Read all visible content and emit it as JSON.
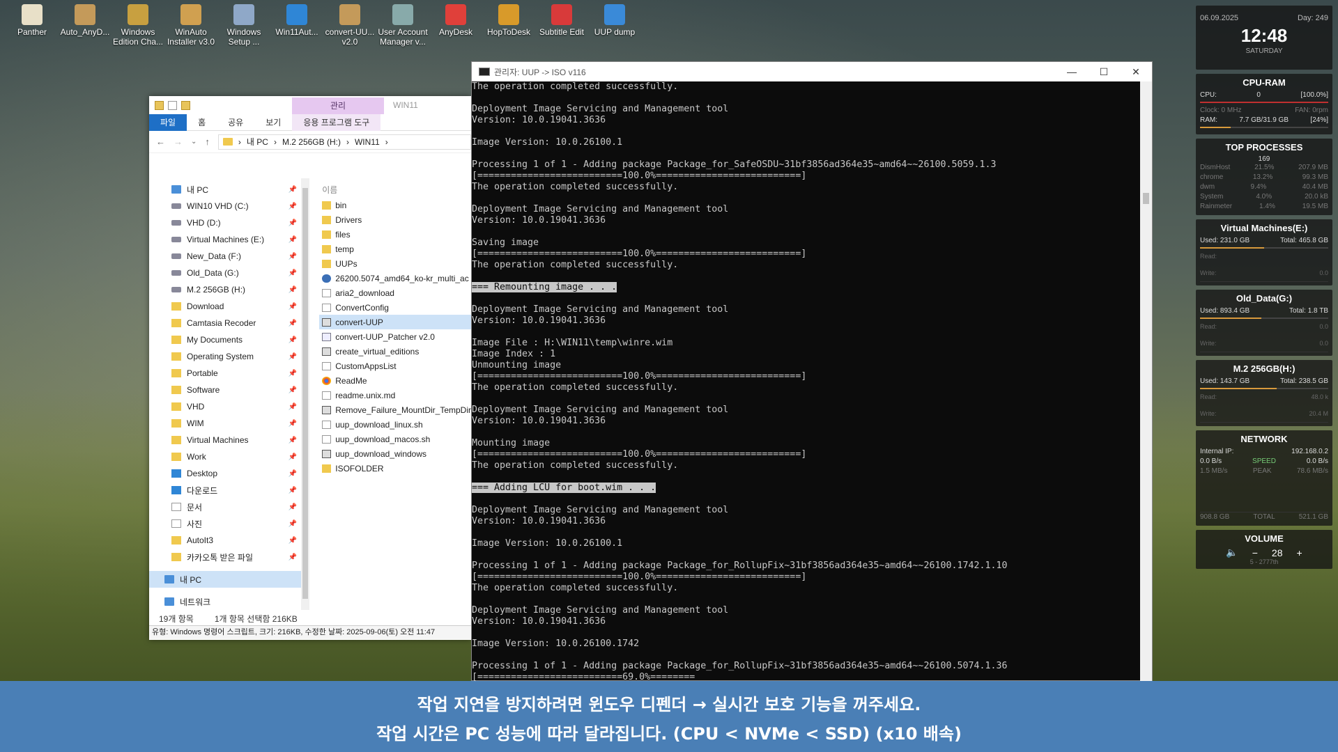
{
  "desktop_icons": [
    {
      "label": "Panther",
      "color": "#e8e0c8"
    },
    {
      "label": "Auto_AnyD...",
      "color": "#c49a5a"
    },
    {
      "label": "Windows Edition Cha...",
      "color": "#c8a040"
    },
    {
      "label": "WinAuto Installer v3.0",
      "color": "#d0a050"
    },
    {
      "label": "Windows Setup ...",
      "color": "#8fa8c8"
    },
    {
      "label": "Win11Aut...",
      "color": "#2f86d6"
    },
    {
      "label": "convert-UU... v2.0",
      "color": "#c49a5a"
    },
    {
      "label": "User Account Manager v...",
      "color": "#8aa"
    },
    {
      "label": "AnyDesk",
      "color": "#e0403a"
    },
    {
      "label": "HopToDesk",
      "color": "#d89a2a"
    },
    {
      "label": "Subtitle Edit",
      "color": "#d83a3a"
    },
    {
      "label": "UUP dump",
      "color": "#3a8ad8"
    }
  ],
  "explorer": {
    "manage_tab": "관리",
    "window_name": "WIN11",
    "ribbon_tabs": [
      "파일",
      "홈",
      "공유",
      "보기",
      "응용 프로그램 도구"
    ],
    "breadcrumb": [
      "내 PC",
      "M.2 256GB (H:)",
      "WIN11"
    ],
    "nav_items": [
      {
        "label": "내 PC",
        "type": "pc"
      },
      {
        "label": "WIN10 VHD (C:)",
        "type": "drive"
      },
      {
        "label": "VHD (D:)",
        "type": "drive"
      },
      {
        "label": "Virtual Machines (E:)",
        "type": "drive"
      },
      {
        "label": "New_Data (F:)",
        "type": "drive"
      },
      {
        "label": "Old_Data (G:)",
        "type": "drive"
      },
      {
        "label": "M.2 256GB (H:)",
        "type": "drive"
      },
      {
        "label": "Download",
        "type": "folder"
      },
      {
        "label": "Camtasia Recoder",
        "type": "folder"
      },
      {
        "label": "My Documents",
        "type": "folder"
      },
      {
        "label": "Operating System",
        "type": "folder"
      },
      {
        "label": "Portable",
        "type": "folder"
      },
      {
        "label": "Software",
        "type": "folder"
      },
      {
        "label": "VHD",
        "type": "folder"
      },
      {
        "label": "WIM",
        "type": "folder"
      },
      {
        "label": "Virtual Machines",
        "type": "folder"
      },
      {
        "label": "Work",
        "type": "folder"
      },
      {
        "label": "Desktop",
        "type": "blue"
      },
      {
        "label": "다운로드",
        "type": "blue"
      },
      {
        "label": "문서",
        "type": "doc"
      },
      {
        "label": "사진",
        "type": "doc"
      },
      {
        "label": "AutoIt3",
        "type": "folder"
      },
      {
        "label": "카카오톡 받은 파일",
        "type": "folder"
      }
    ],
    "nav_bottom": [
      "내 PC",
      "네트워크"
    ],
    "column_header": "이름",
    "files": [
      {
        "name": "bin",
        "type": "folder"
      },
      {
        "name": "Drivers",
        "type": "folder"
      },
      {
        "name": "files",
        "type": "folder"
      },
      {
        "name": "temp",
        "type": "folder"
      },
      {
        "name": "UUPs",
        "type": "folder"
      },
      {
        "name": "26200.5074_amd64_ko-kr_multi_ac",
        "type": "zip"
      },
      {
        "name": "aria2_download",
        "type": "doc"
      },
      {
        "name": "ConvertConfig",
        "type": "doc"
      },
      {
        "name": "convert-UUP",
        "type": "cmd",
        "selected": true
      },
      {
        "name": "convert-UUP_Patcher v2.0",
        "type": "script"
      },
      {
        "name": "create_virtual_editions",
        "type": "cmd"
      },
      {
        "name": "CustomAppsList",
        "type": "doc"
      },
      {
        "name": "ReadMe",
        "type": "chrome"
      },
      {
        "name": "readme.unix.md",
        "type": "doc"
      },
      {
        "name": "Remove_Failure_MountDir_TempDir",
        "type": "cmd"
      },
      {
        "name": "uup_download_linux.sh",
        "type": "doc"
      },
      {
        "name": "uup_download_macos.sh",
        "type": "doc"
      },
      {
        "name": "uup_download_windows",
        "type": "cmd"
      },
      {
        "name": "ISOFOLDER",
        "type": "folder"
      }
    ],
    "status_count": "19개 항목",
    "status_selected": "1개 항목 선택함 216KB",
    "tooltip": "유형: Windows 명령어 스크립트, 크기: 216KB, 수정한 날짜: 2025-09-06(토) 오전 11:47"
  },
  "console": {
    "title": "관리자:  UUP -> ISO v116",
    "lines": [
      {
        "t": "The operation completed successfully."
      },
      {
        "t": ""
      },
      {
        "t": "Deployment Image Servicing and Management tool"
      },
      {
        "t": "Version: 10.0.19041.3636"
      },
      {
        "t": ""
      },
      {
        "t": "Image Version: 10.0.26100.1"
      },
      {
        "t": ""
      },
      {
        "t": "Processing 1 of 1 - Adding package Package_for_SafeOSDU~31bf3856ad364e35~amd64~~26100.5059.1.3"
      },
      {
        "t": "[==========================100.0%==========================]"
      },
      {
        "t": "The operation completed successfully."
      },
      {
        "t": ""
      },
      {
        "t": "Deployment Image Servicing and Management tool"
      },
      {
        "t": "Version: 10.0.19041.3636"
      },
      {
        "t": ""
      },
      {
        "t": "Saving image"
      },
      {
        "t": "[==========================100.0%==========================]"
      },
      {
        "t": "The operation completed successfully."
      },
      {
        "t": ""
      },
      {
        "t": "=== Remounting image . . .",
        "hl": true
      },
      {
        "t": ""
      },
      {
        "t": "Deployment Image Servicing and Management tool"
      },
      {
        "t": "Version: 10.0.19041.3636"
      },
      {
        "t": ""
      },
      {
        "t": "Image File : H:\\WIN11\\temp\\winre.wim"
      },
      {
        "t": "Image Index : 1"
      },
      {
        "t": "Unmounting image"
      },
      {
        "t": "[==========================100.0%==========================]"
      },
      {
        "t": "The operation completed successfully."
      },
      {
        "t": ""
      },
      {
        "t": "Deployment Image Servicing and Management tool"
      },
      {
        "t": "Version: 10.0.19041.3636"
      },
      {
        "t": ""
      },
      {
        "t": "Mounting image"
      },
      {
        "t": "[==========================100.0%==========================]"
      },
      {
        "t": "The operation completed successfully."
      },
      {
        "t": ""
      },
      {
        "t": "=== Adding LCU for boot.wim . . .",
        "hl": true
      },
      {
        "t": ""
      },
      {
        "t": "Deployment Image Servicing and Management tool"
      },
      {
        "t": "Version: 10.0.19041.3636"
      },
      {
        "t": ""
      },
      {
        "t": "Image Version: 10.0.26100.1"
      },
      {
        "t": ""
      },
      {
        "t": "Processing 1 of 1 - Adding package Package_for_RollupFix~31bf3856ad364e35~amd64~~26100.1742.1.10"
      },
      {
        "t": "[==========================100.0%==========================]"
      },
      {
        "t": "The operation completed successfully."
      },
      {
        "t": ""
      },
      {
        "t": "Deployment Image Servicing and Management tool"
      },
      {
        "t": "Version: 10.0.19041.3636"
      },
      {
        "t": ""
      },
      {
        "t": "Image Version: 10.0.26100.1742"
      },
      {
        "t": ""
      },
      {
        "t": "Processing 1 of 1 - Adding package Package_for_RollupFix~31bf3856ad364e35~amd64~~26100.5074.1.36"
      },
      {
        "t": "[==========================69.0%========"
      }
    ]
  },
  "widgets": {
    "clock": {
      "date": "06.09.2025",
      "day": "Day: 249",
      "time": "12:48",
      "weekday": "SATURDAY"
    },
    "cpu_ram": {
      "title": "CPU-RAM",
      "cpu_label": "CPU:",
      "cpu_value": "0",
      "cpu_pct": "[100.0%]",
      "clock": "Clock: 0 MHz",
      "fan": "FAN: 0rpm",
      "ram_label": "RAM:",
      "ram_value": "7.7 GB/31.9 GB",
      "ram_pct": "[24%]",
      "ram_fraction": 0.24
    },
    "top": {
      "title": "TOP PROCESSES",
      "count": "169",
      "rows": [
        {
          "name": "DismHost",
          "cpu": "21.5%",
          "mem": "207.9 MB"
        },
        {
          "name": "chrome",
          "cpu": "13.2%",
          "mem": "99.3 MB"
        },
        {
          "name": "dwm",
          "cpu": "9.4%",
          "mem": "40.4 MB"
        },
        {
          "name": "System",
          "cpu": "4.0%",
          "mem": "20.0 kB"
        },
        {
          "name": "Rainmeter",
          "cpu": "1.4%",
          "mem": "19.5 MB"
        }
      ]
    },
    "drives": [
      {
        "title": "Virtual Machines(E:)",
        "used": "Used: 231.0 GB",
        "total": "Total: 465.8 GB",
        "fraction": 0.5,
        "read": "Read:",
        "write": "Write:",
        "read_val": "",
        "write_val": "0.0"
      },
      {
        "title": "Old_Data(G:)",
        "used": "Used: 893.4 GB",
        "total": "Total: 1.8 TB",
        "fraction": 0.48,
        "read": "Read:",
        "write": "Write:",
        "read_val": "0.0",
        "write_val": "0.0"
      },
      {
        "title": "M.2 256GB(H:)",
        "used": "Used: 143.7 GB",
        "total": "Total: 238.5 GB",
        "fraction": 0.6,
        "read": "Read:",
        "write": "Write:",
        "read_val": "48.0 k",
        "write_val": "20.4 M"
      }
    ],
    "network": {
      "title": "NETWORK",
      "ip_label": "Internal IP:",
      "ip": "192.168.0.2",
      "down": "0.0 B/s",
      "speed": "SPEED",
      "up": "0.0 B/s",
      "peak_down": "1.5 MB/s",
      "peak": "PEAK",
      "peak_up": "78.6 MB/s",
      "total_down": "908.8 GB",
      "total": "TOTAL",
      "total_up": "521.1 GB"
    },
    "volume": {
      "title": "VOLUME",
      "value": "28",
      "minus": "−",
      "plus": "+",
      "sub": "5 - 2777th"
    }
  },
  "banner": {
    "line1": "작업 지연을 방지하려면 윈도우 디펜더 → 실시간 보호 기능을 꺼주세요.",
    "line2": "작업 시간은 PC 성능에 따라 달라집니다. (CPU < NVMe < SSD) (x10 배속)"
  }
}
